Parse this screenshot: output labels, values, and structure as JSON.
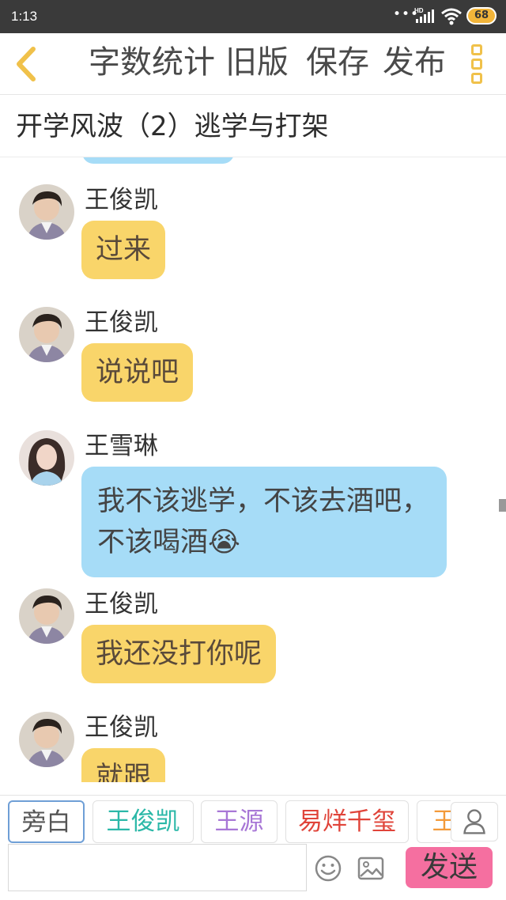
{
  "status_bar": {
    "time": "1:13",
    "network": "HD",
    "battery": "68"
  },
  "nav": {
    "back_icon": "chevron-left-icon",
    "word_count": "字数统计",
    "old_version": "旧版",
    "save": "保存",
    "publish": "发布",
    "more_icon": "more-vertical-icon",
    "accent_color": "#f0c14a"
  },
  "chapter": {
    "title": "开学风波（2）逃学与打架"
  },
  "messages": [
    {
      "sender": "王俊凯",
      "text": "过来",
      "style": "yellow"
    },
    {
      "sender": "王俊凯",
      "text": "说说吧",
      "style": "yellow"
    },
    {
      "sender": "王雪琳",
      "text": "我不该逃学，不该去酒吧，不该喝酒😭",
      "style": "blue"
    },
    {
      "sender": "王俊凯",
      "text": "我还没打你呢",
      "style": "yellow"
    },
    {
      "sender": "王俊凯",
      "text": "就跟",
      "style": "yellow"
    }
  ],
  "roles": [
    {
      "label": "旁白",
      "color": "#555555"
    },
    {
      "label": "王俊凯",
      "color": "#2bb8a8"
    },
    {
      "label": "王源",
      "color": "#a877d6"
    },
    {
      "label": "易烊千玺",
      "color": "#e0443a"
    },
    {
      "label": "王",
      "color": "#f39a3a"
    }
  ],
  "input": {
    "placeholder": "",
    "emoji_icon": "smiley-icon",
    "image_icon": "image-icon",
    "user_icon": "user-icon",
    "send": "发送"
  },
  "colors": {
    "bubble_yellow": "#f9d56a",
    "bubble_blue": "#a6dcf7",
    "send_button": "#f56fa0"
  }
}
